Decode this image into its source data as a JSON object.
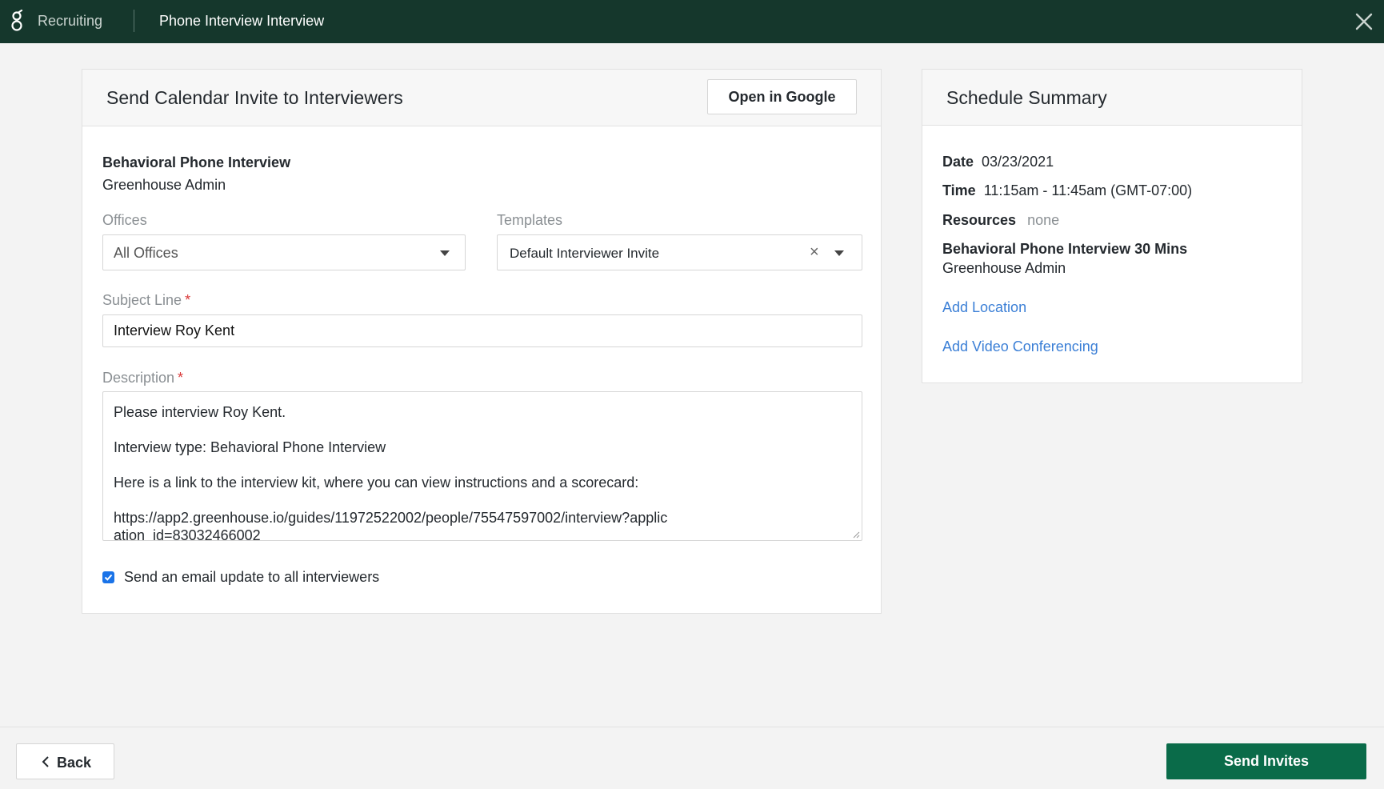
{
  "topbar": {
    "app_name": "Recruiting",
    "page_title": "Phone Interview Interview",
    "logo_icon": "greenhouse-logo-icon",
    "close_icon": "close-icon"
  },
  "main": {
    "title": "Send Calendar Invite to Interviewers",
    "open_google_label": "Open in Google",
    "interview_name": "Behavioral Phone Interview",
    "interviewer": "Greenhouse Admin",
    "offices": {
      "label": "Offices",
      "value": "All Offices"
    },
    "templates": {
      "label": "Templates",
      "value": "Default Interviewer Invite"
    },
    "subject": {
      "label": "Subject Line",
      "required_mark": "*",
      "value": "Interview Roy Kent"
    },
    "description": {
      "label": "Description",
      "required_mark": "*",
      "lines": [
        "Please interview Roy Kent.",
        "Interview type: Behavioral Phone Interview",
        "Here is a link to the interview kit, where you can view instructions and a scorecard:",
        "https://app2.greenhouse.io/guides/11972522002/people/75547597002/interview?application_id=83032466002"
      ]
    },
    "email_update": {
      "checked": true,
      "label": "Send an email update to all interviewers"
    }
  },
  "summary": {
    "title": "Schedule Summary",
    "date_key": "Date",
    "date_value": "03/23/2021",
    "time_key": "Time",
    "time_value": "11:15am - 11:45am (GMT-07:00)",
    "resources_key": "Resources",
    "resources_value": "none",
    "interview_title": "Behavioral Phone Interview 30 Mins",
    "interviewer": "Greenhouse Admin",
    "add_location": "Add Location",
    "add_video": "Add Video Conferencing"
  },
  "footer": {
    "back_label": "Back",
    "send_label": "Send Invites"
  },
  "colors": {
    "topbar": "#15372c",
    "primary_button": "#0a6b49",
    "link": "#3b7fd6",
    "required": "#d93838"
  }
}
